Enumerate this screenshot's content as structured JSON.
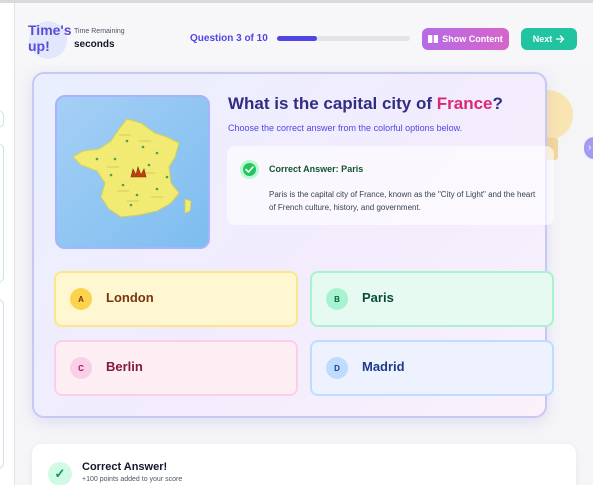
{
  "timer": {
    "title": "Time's up!",
    "label": "Time Remaining",
    "value": "seconds"
  },
  "progress": {
    "question_label": "Question 3 of 10",
    "fraction": 0.3
  },
  "toolbar": {
    "show_content_label": "Show Content",
    "next_label": "Next"
  },
  "question": {
    "title_prefix": "What is the capital city of ",
    "title_highlight": "France",
    "title_suffix": "?",
    "subtitle": "Choose the correct answer from the colorful options below."
  },
  "answer": {
    "title": "Correct Answer: Paris",
    "explanation": "Paris is the capital city of France, known as the \"City of Light\" and the heart of French culture, history, and government."
  },
  "options": [
    {
      "letter": "A",
      "text": "London"
    },
    {
      "letter": "B",
      "text": "Paris"
    },
    {
      "letter": "C",
      "text": "Berlin"
    },
    {
      "letter": "D",
      "text": "Madrid"
    }
  ],
  "feedback": {
    "title": "Correct Answer!",
    "subtitle": "+100 points added to your score"
  },
  "colors": {
    "accent": "#4f46e5",
    "correct": "#22c55e",
    "highlight": "#db2777",
    "next_button": "#22c3a0"
  },
  "icons": {
    "show_content": "book-icon",
    "next": "arrow-right-icon",
    "correct": "check-circle-icon",
    "map": "france-map-icon"
  }
}
